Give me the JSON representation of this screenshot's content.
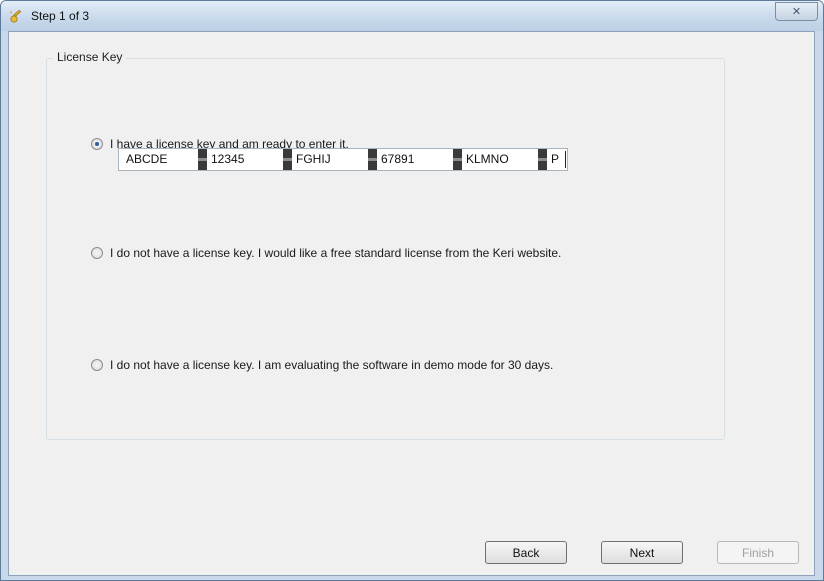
{
  "window": {
    "title": "Step 1 of 3",
    "close_label": "✕"
  },
  "group": {
    "legend": "License Key"
  },
  "options": [
    {
      "label": "I have a license key and am ready to enter it.",
      "checked": true
    },
    {
      "label": "I do not have a license key.  I would like a free standard license from the Keri website.",
      "checked": false
    },
    {
      "label": "I do not have a license key.  I am evaluating the software in demo mode for 30 days.",
      "checked": false
    }
  ],
  "license_key": {
    "segments": [
      "ABCDE",
      "12345",
      "FGHIJ",
      "67891",
      "KLMNO",
      "P"
    ]
  },
  "buttons": {
    "back": "Back",
    "next": "Next",
    "finish": "Finish"
  },
  "icons": {
    "app": "wizard-key-icon",
    "close": "close-icon"
  }
}
